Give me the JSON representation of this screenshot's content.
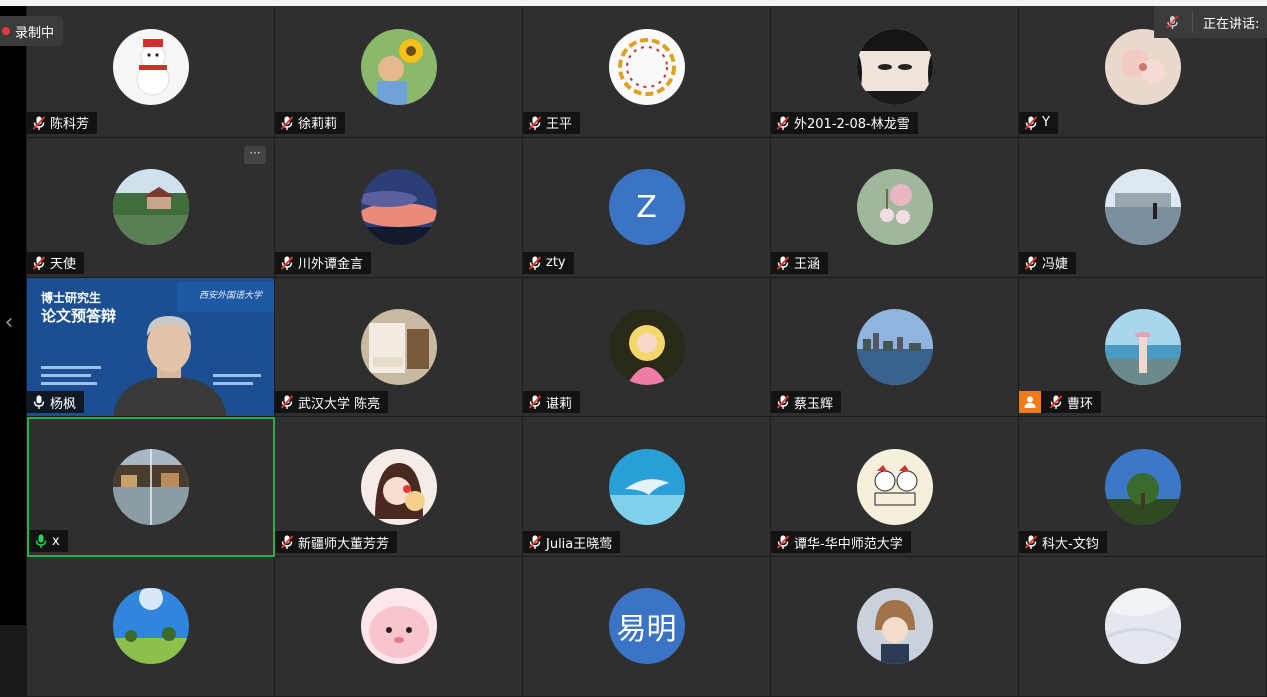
{
  "recording": {
    "label": "录制中"
  },
  "speaking": {
    "label": "正在讲话:"
  },
  "colors": {
    "active_border": "#22b14c",
    "muted_mic": "#ffffff",
    "active_mic": "#2fd05a",
    "badge": "#f07b1c"
  },
  "presenter_slide": {
    "line1": "博士研究生",
    "line2": "论文预答辩",
    "logo": "西安外国语大学"
  },
  "participants": [
    {
      "name": "陈科芳",
      "avatar": "snowman",
      "mic": "muted"
    },
    {
      "name": "徐莉莉",
      "avatar": "child-sunflower",
      "mic": "muted"
    },
    {
      "name": "王平",
      "avatar": "ring-diagram",
      "mic": "muted"
    },
    {
      "name": "外201-2-08-林龙雪",
      "avatar": "girl-eyes",
      "mic": "muted"
    },
    {
      "name": "Y",
      "avatar": "pink-blossom",
      "mic": "muted"
    },
    {
      "name": "天使",
      "avatar": "lake-pavilion",
      "mic": "muted",
      "more": "···"
    },
    {
      "name": "川外谭金言",
      "avatar": "sunset-sky",
      "mic": "muted"
    },
    {
      "name": "zty",
      "avatar": "initial",
      "initial": "Z",
      "avatar_color": "#3b74c4",
      "mic": "muted"
    },
    {
      "name": "王涵",
      "avatar": "cherry-flowers",
      "mic": "muted"
    },
    {
      "name": "冯婕",
      "avatar": "lake-person",
      "mic": "muted"
    },
    {
      "name": "杨枫",
      "avatar": "video",
      "mic": "on"
    },
    {
      "name": "武汉大学 陈亮",
      "avatar": "hotel-room",
      "mic": "muted"
    },
    {
      "name": "谌莉",
      "avatar": "anime-girl",
      "mic": "muted"
    },
    {
      "name": "蔡玉辉",
      "avatar": "city-harbor",
      "mic": "muted"
    },
    {
      "name": "曹环",
      "avatar": "seaside-woman",
      "mic": "muted",
      "badge": "person"
    },
    {
      "name": "x",
      "avatar": "water-town",
      "mic": "active",
      "active": true
    },
    {
      "name": "新疆师大董芳芳",
      "avatar": "cartoon-girl",
      "mic": "muted"
    },
    {
      "name": "Julia王晓莺",
      "avatar": "dolphin",
      "mic": "muted"
    },
    {
      "name": "谭华-华中师范大学",
      "avatar": "doodle-cats",
      "mic": "muted"
    },
    {
      "name": "科大-文钧",
      "avatar": "tree-sky",
      "mic": "muted"
    },
    {
      "name": "",
      "avatar": "blue-sky-field",
      "mic": "none"
    },
    {
      "name": "",
      "avatar": "pink-blob",
      "mic": "none"
    },
    {
      "name": "",
      "avatar": "initial",
      "initial": "易明",
      "avatar_color": "#3b74c4",
      "mic": "none"
    },
    {
      "name": "",
      "avatar": "anime-boy",
      "mic": "none"
    },
    {
      "name": "",
      "avatar": "white-fabric",
      "mic": "none"
    }
  ]
}
